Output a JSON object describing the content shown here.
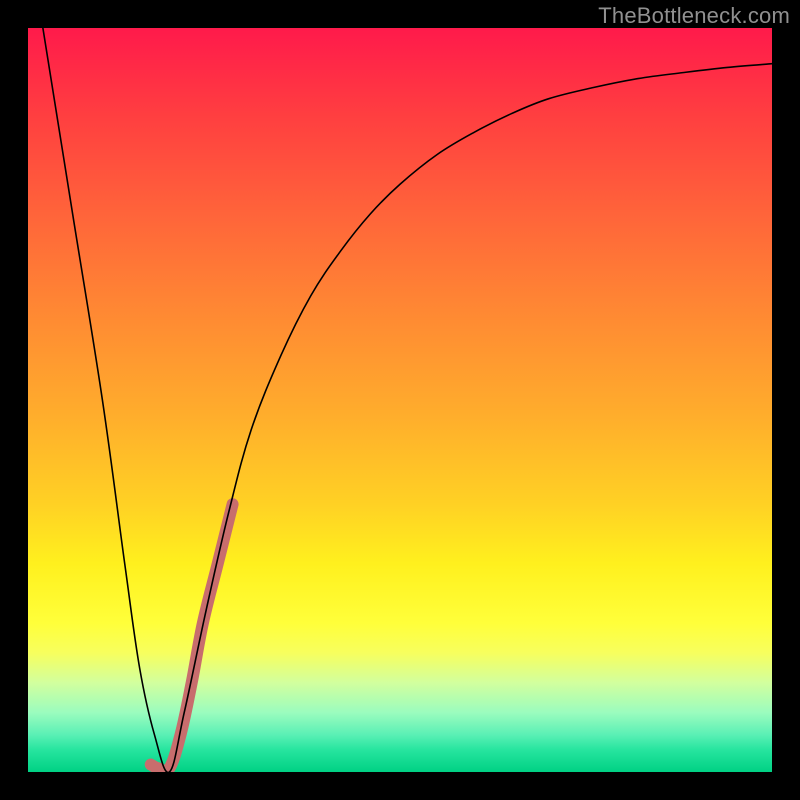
{
  "watermark": "TheBottleneck.com",
  "chart_data": {
    "type": "line",
    "title": "",
    "xlabel": "",
    "ylabel": "",
    "xlim": [
      0,
      100
    ],
    "ylim": [
      0,
      100
    ],
    "grid": false,
    "series": [
      {
        "name": "black-curve",
        "color": "#000000",
        "stroke_width": 1.6,
        "x": [
          2,
          6,
          10,
          13,
          15,
          17,
          19,
          21,
          24,
          27,
          30,
          34,
          38,
          42,
          46,
          50,
          55,
          60,
          65,
          70,
          76,
          82,
          88,
          94,
          100
        ],
        "values": [
          100,
          75,
          50,
          28,
          14,
          5,
          0,
          8,
          22,
          35,
          46,
          56,
          64,
          70,
          75,
          79,
          83,
          86,
          88.5,
          90.5,
          92,
          93.2,
          94,
          94.7,
          95.2
        ]
      },
      {
        "name": "pink-highlight",
        "color": "#c86d6d",
        "stroke_width": 12,
        "x": [
          16.5,
          17.5,
          19,
          20.5,
          22,
          23.5,
          25.5,
          27.5
        ],
        "values": [
          1,
          0.5,
          0.5,
          5,
          12,
          20,
          28,
          36
        ]
      }
    ],
    "gradient_stops": [
      {
        "pct": 0,
        "color": "#ff1a4b"
      },
      {
        "pct": 12,
        "color": "#ff3f40"
      },
      {
        "pct": 25,
        "color": "#ff643a"
      },
      {
        "pct": 38,
        "color": "#ff8833"
      },
      {
        "pct": 52,
        "color": "#ffad2c"
      },
      {
        "pct": 64,
        "color": "#ffd124"
      },
      {
        "pct": 72,
        "color": "#fff01e"
      },
      {
        "pct": 80,
        "color": "#ffff3a"
      },
      {
        "pct": 84,
        "color": "#f7ff5e"
      },
      {
        "pct": 88,
        "color": "#d2ff9e"
      },
      {
        "pct": 92,
        "color": "#9bfcbe"
      },
      {
        "pct": 95,
        "color": "#5af0b5"
      },
      {
        "pct": 97,
        "color": "#27e59f"
      },
      {
        "pct": 100,
        "color": "#00d184"
      }
    ]
  }
}
